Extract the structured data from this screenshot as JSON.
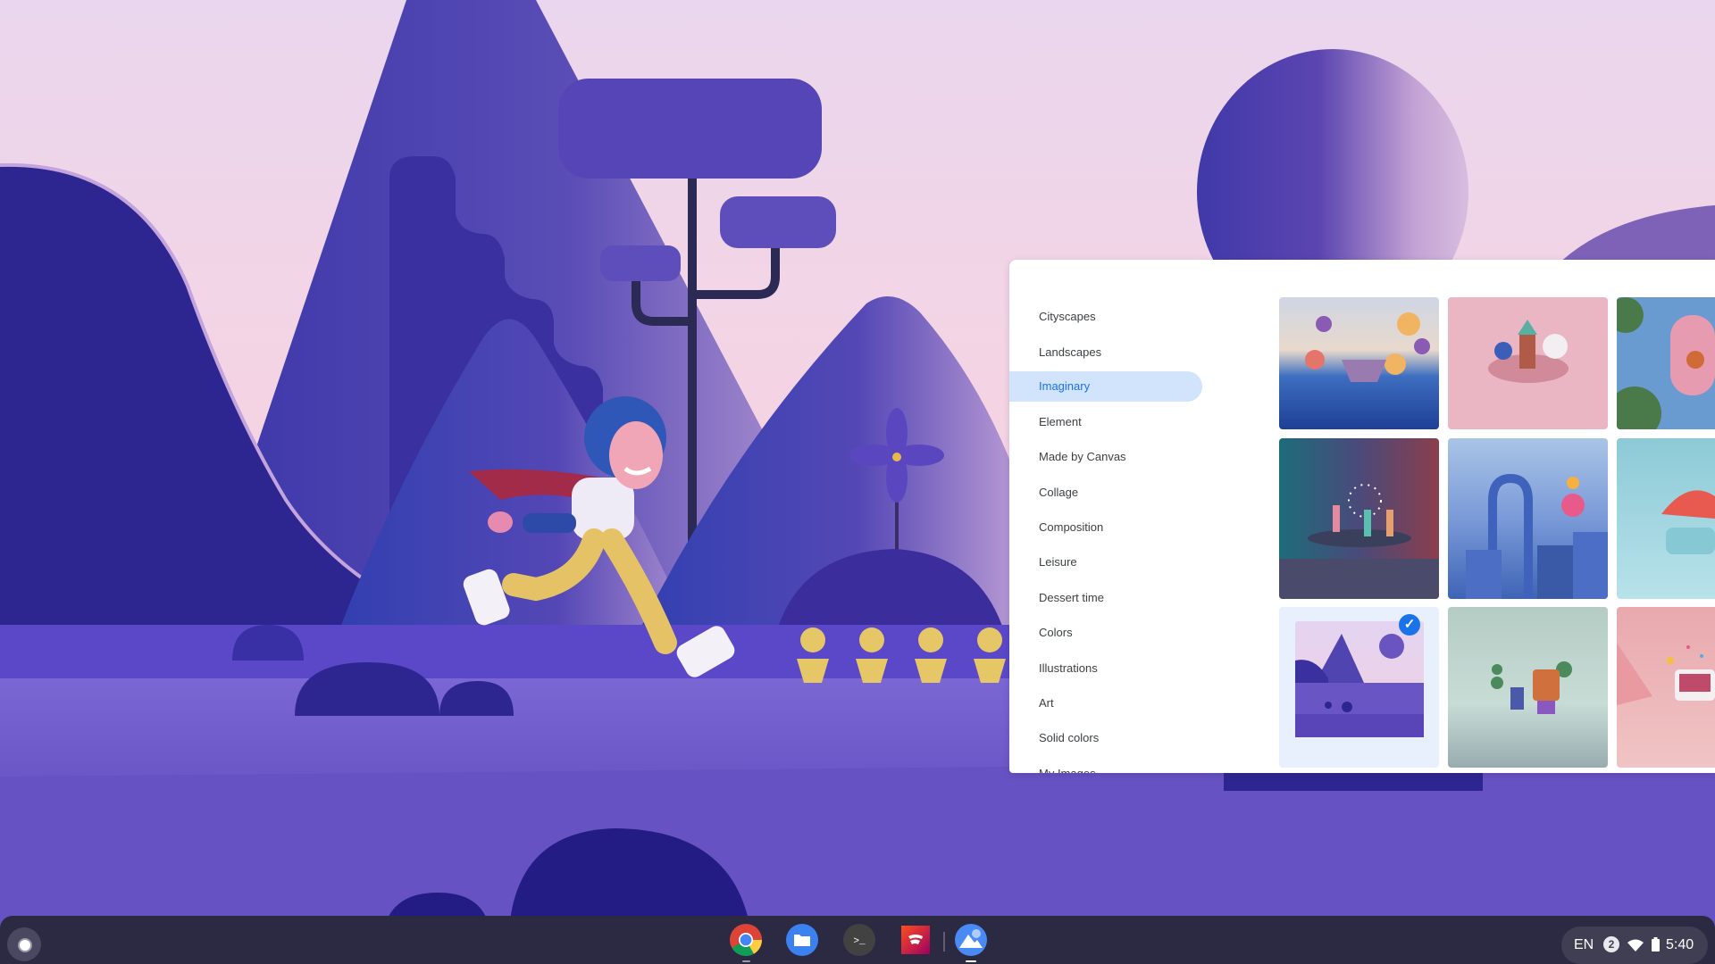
{
  "wallpaper": {
    "name": "imaginary-runner-with-ducklings",
    "colors": {
      "sky_top": "#ead6ee",
      "sky_bottom": "#f7d3df",
      "hill_dark": "#2e2590",
      "hill_mid": "#4a44b5",
      "ground_light": "#8470d6",
      "ground_mid": "#6a55c4"
    }
  },
  "wallpaper_picker": {
    "categories": [
      {
        "label": "Cityscapes",
        "selected": false
      },
      {
        "label": "Landscapes",
        "selected": false
      },
      {
        "label": "Imaginary",
        "selected": true
      },
      {
        "label": "Element",
        "selected": false
      },
      {
        "label": "Made by Canvas",
        "selected": false
      },
      {
        "label": "Collage",
        "selected": false
      },
      {
        "label": "Composition",
        "selected": false
      },
      {
        "label": "Leisure",
        "selected": false
      },
      {
        "label": "Dessert time",
        "selected": false
      },
      {
        "label": "Colors",
        "selected": false
      },
      {
        "label": "Illustrations",
        "selected": false
      },
      {
        "label": "Art",
        "selected": false
      },
      {
        "label": "Solid colors",
        "selected": false
      },
      {
        "label": "My Images",
        "selected": false
      }
    ],
    "thumbnails": [
      {
        "name": "balloons-boat-waves",
        "selected": false,
        "colors": [
          "#cfd6e4",
          "#2d5bb0"
        ]
      },
      {
        "name": "pink-castle-creatures",
        "selected": false,
        "colors": [
          "#eab6c3",
          "#e0a6b6"
        ]
      },
      {
        "name": "basketball-court-topdown",
        "selected": false,
        "colors": [
          "#6a9bd0",
          "#e79bb0"
        ]
      },
      {
        "name": "dancers-stage",
        "selected": false,
        "colors": [
          "#1d6c7a",
          "#8a3e4c"
        ]
      },
      {
        "name": "arch-blocks-blue",
        "selected": false,
        "colors": [
          "#a9c4e6",
          "#3e64b5"
        ]
      },
      {
        "name": "watermelon-character",
        "selected": false,
        "colors": [
          "#8ccad6",
          "#b8e2ea"
        ]
      },
      {
        "name": "runner-ducklings-purple",
        "selected": true,
        "colors": [
          "#e4d4f2",
          "#5a45b8"
        ]
      },
      {
        "name": "robot-green-trees",
        "selected": false,
        "colors": [
          "#b4ccc4",
          "#98acb0"
        ]
      },
      {
        "name": "pink-confetti-tablet",
        "selected": false,
        "colors": [
          "#e9a9ae",
          "#f0c4c4"
        ]
      }
    ],
    "selected_check_icon": "✓",
    "accent": "#1a73e8",
    "selected_bg": "#d2e3fc"
  },
  "shelf": {
    "apps": [
      {
        "name": "chrome",
        "running": true,
        "active": false
      },
      {
        "name": "files",
        "running": false,
        "active": false
      },
      {
        "name": "terminal",
        "running": false,
        "active": false,
        "glyph": ">_"
      },
      {
        "name": "stadia",
        "running": false,
        "active": false
      },
      {
        "name": "wallpaper",
        "running": true,
        "active": true
      }
    ],
    "tray": {
      "ime": "EN",
      "notifications": "2",
      "time": "5:40"
    }
  }
}
